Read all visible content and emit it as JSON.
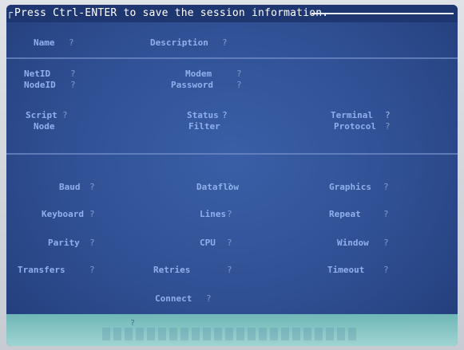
{
  "header": {
    "message": "Press Ctrl-ENTER to save the session information."
  },
  "colors": {
    "screen_blue": "#2f4f93",
    "top_bar": "#1f3770",
    "bottom_bar": "#9fd4d2",
    "label_blue": "#8fb0ec"
  },
  "top_section": {
    "name_label": "Name",
    "name_value": "?",
    "description_label": "Description",
    "description_value": "?",
    "netid_label": "NetID",
    "netid_value": "?",
    "nodeid_label": "NodeID",
    "nodeid_value": "?",
    "modem_label": "Modem",
    "modem_value": "?",
    "password_label": "Password",
    "password_value": "?",
    "script_label": "Script",
    "script_value": "?",
    "status_label": "Status",
    "status_value": "?",
    "node_label": "Node",
    "filter_label": "Filter",
    "terminal_label": "Terminal",
    "terminal_value": "?",
    "protocol_label": "Protocol",
    "protocol_value": "?"
  },
  "settings": {
    "baud_label": "Baud",
    "baud_value": "?",
    "dataflow_label": "Dataflow",
    "dataflow_value": "?",
    "graphics_label": "Graphics",
    "graphics_value": "?",
    "keyboard_label": "Keyboard",
    "keyboard_value": "?",
    "lines_label": "Lines",
    "lines_value": "?",
    "repeat_label": "Repeat",
    "repeat_value": "?",
    "parity_label": "Parity",
    "parity_value": "?",
    "cpu_label": "CPU",
    "cpu_value": "?",
    "window_label": "Window",
    "window_value": "?",
    "transfers_label": "Transfers",
    "transfers_value": "?",
    "retries_label": "Retries",
    "retries_value": "?",
    "timeout_label": "Timeout",
    "timeout_value": "?",
    "connect_label": "Connect",
    "connect_value": "?"
  },
  "footer": {
    "message": "?"
  }
}
